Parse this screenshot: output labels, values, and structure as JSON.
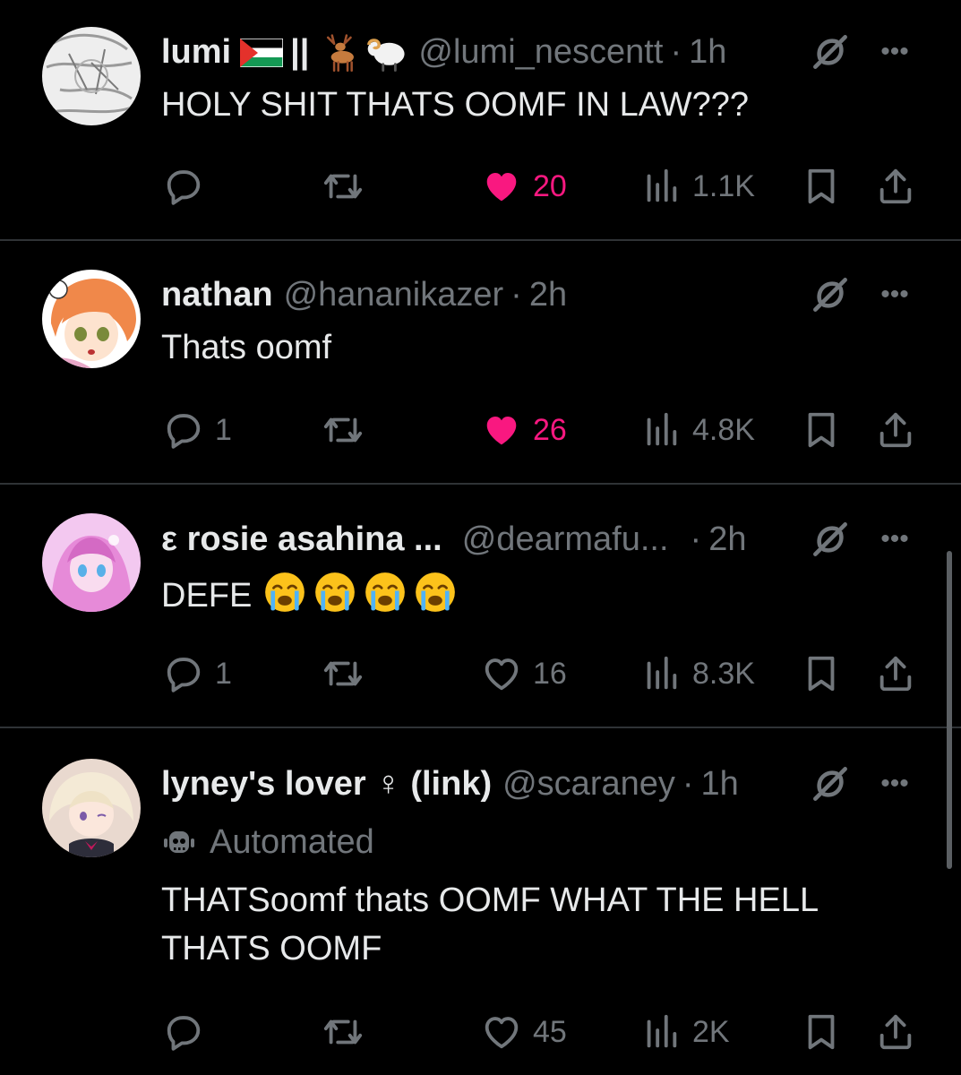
{
  "colors": {
    "background": "#000000",
    "text": "#e7e9ea",
    "secondary": "#71767b",
    "like": "#f91880",
    "divider": "#2f3336"
  },
  "tweets": [
    {
      "name": "lumi",
      "name_suffix": "||",
      "handle": "@lumi_nescentt",
      "separator": "·",
      "time": "1h",
      "text": "HOLY SHIT THATS OOMF IN LAW???",
      "replies": "",
      "likes": "20",
      "liked": true,
      "views": "1.1K"
    },
    {
      "name": "nathan",
      "handle": "@hananikazer",
      "separator": "·",
      "time": "2h",
      "text": "Thats oomf",
      "replies": "1",
      "likes": "26",
      "liked": true,
      "views": "4.8K"
    },
    {
      "name": "ε rosie asahina ...",
      "handle": "@dearmafu...",
      "separator": "·",
      "time": "2h",
      "text": "DEFE",
      "replies": "1",
      "likes": "16",
      "liked": false,
      "views": "8.3K"
    },
    {
      "name": "lyney's lover ♀ (link)",
      "handle": "@scaraney",
      "separator": "·",
      "time": "1h",
      "automated_label": "Automated",
      "text_line1": "THATSoomf thats OOMF WHAT THE HELL",
      "text_line2": "THATS OOMF",
      "replies": "",
      "likes": "45",
      "liked": false,
      "views": "2K"
    }
  ],
  "more_glyph": "•••",
  "icons": [
    "reply-icon",
    "retweet-icon",
    "heart-icon",
    "views-icon",
    "bookmark-icon",
    "share-icon",
    "grok-icon",
    "more-icon",
    "automated-bot-icon",
    "crying-emoji-icon",
    "palestine-flag-icon",
    "deer-emoji-icon",
    "ram-emoji-icon"
  ]
}
